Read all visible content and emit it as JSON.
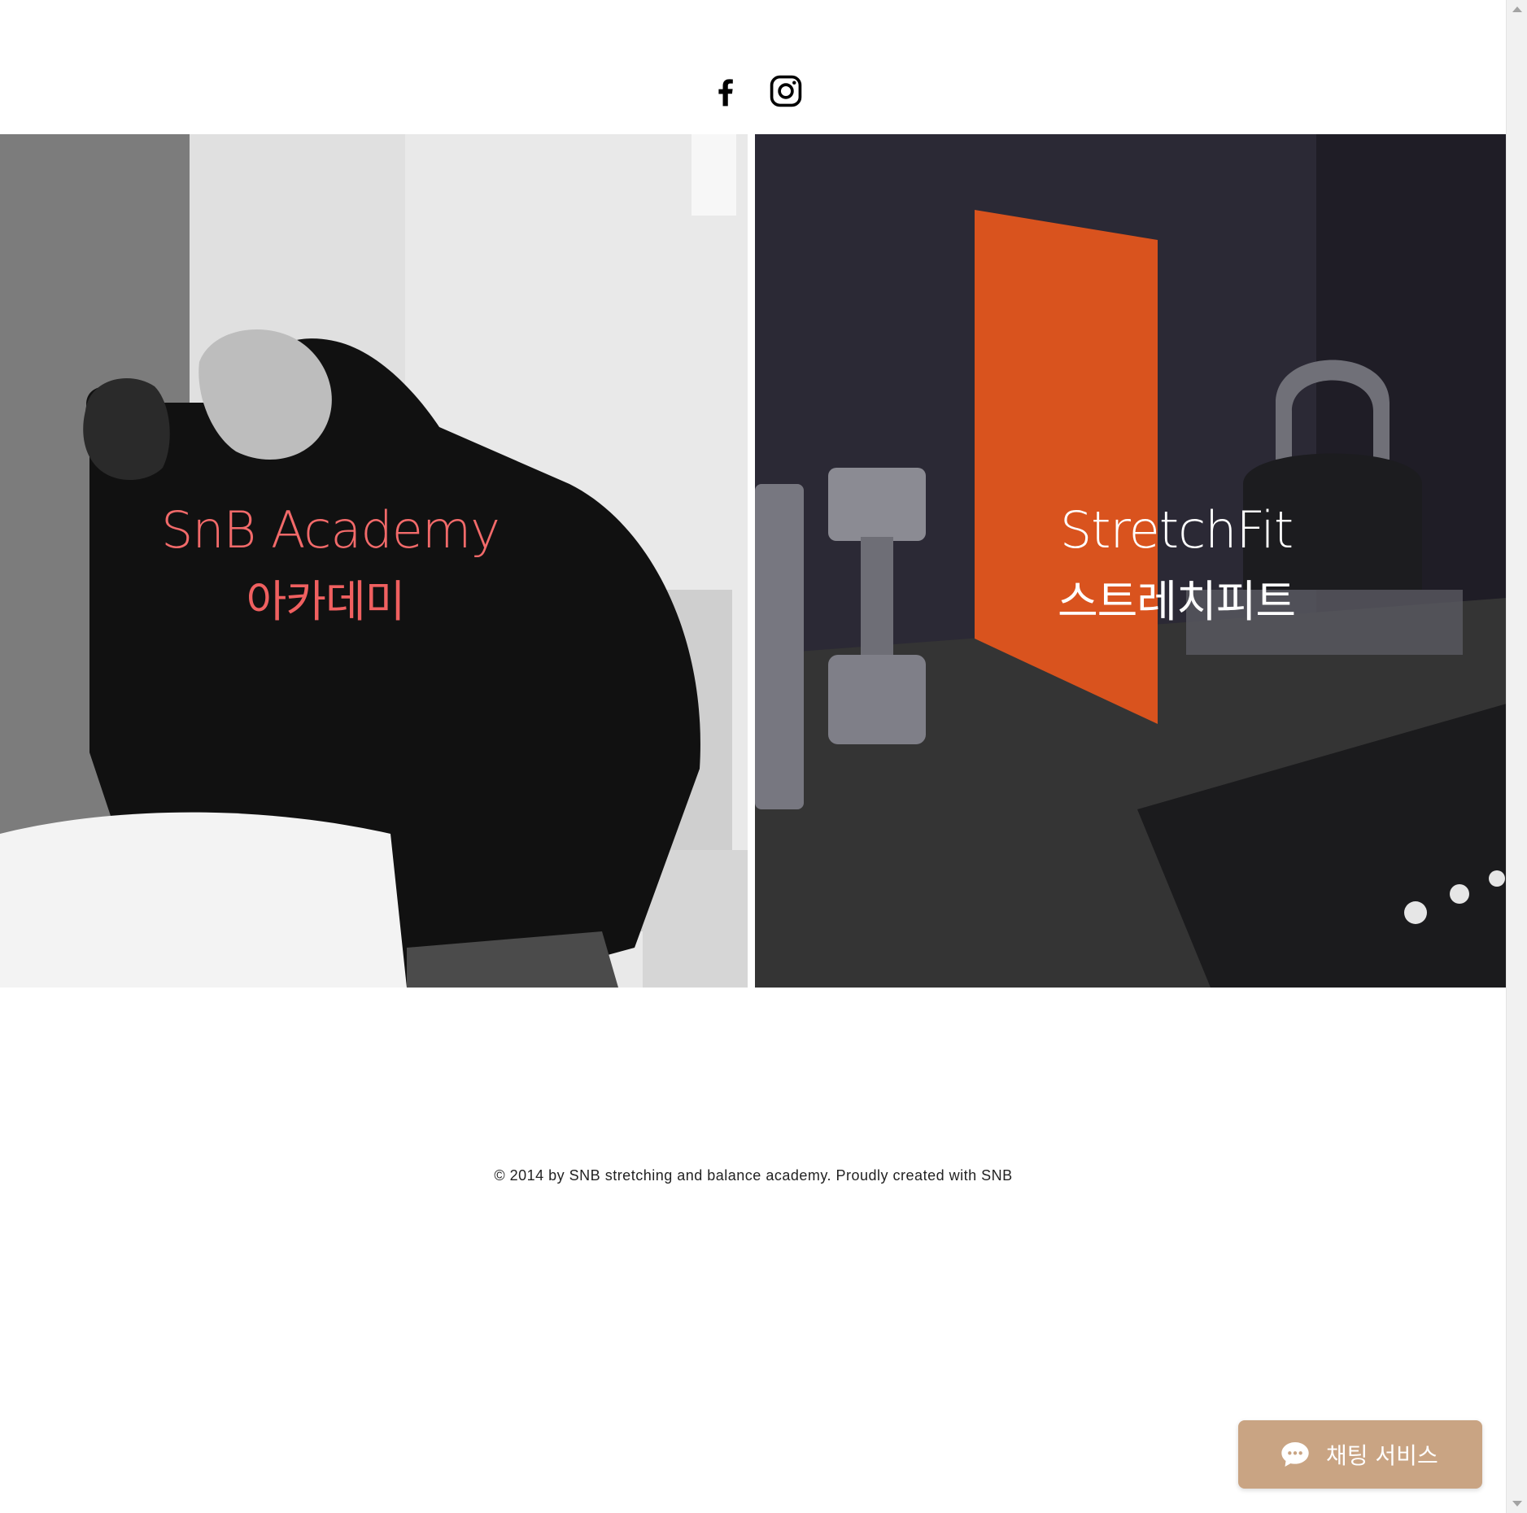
{
  "social": {
    "facebook_icon": "facebook-icon",
    "instagram_icon": "instagram-icon"
  },
  "panels": [
    {
      "title_en": "SnB Academy",
      "title_ko": "아카데미",
      "title_color": "#f26a6a"
    },
    {
      "title_en": "StretchFit",
      "title_ko": "스트레치피트",
      "title_color": "#ffffff"
    }
  ],
  "footer": {
    "copyright": "© 2014 by SNB stretching and balance academy. Proudly created with SNB"
  },
  "chat": {
    "label": "채팅 서비스",
    "icon": "chat-bubble-icon",
    "color": "#c9a483"
  }
}
